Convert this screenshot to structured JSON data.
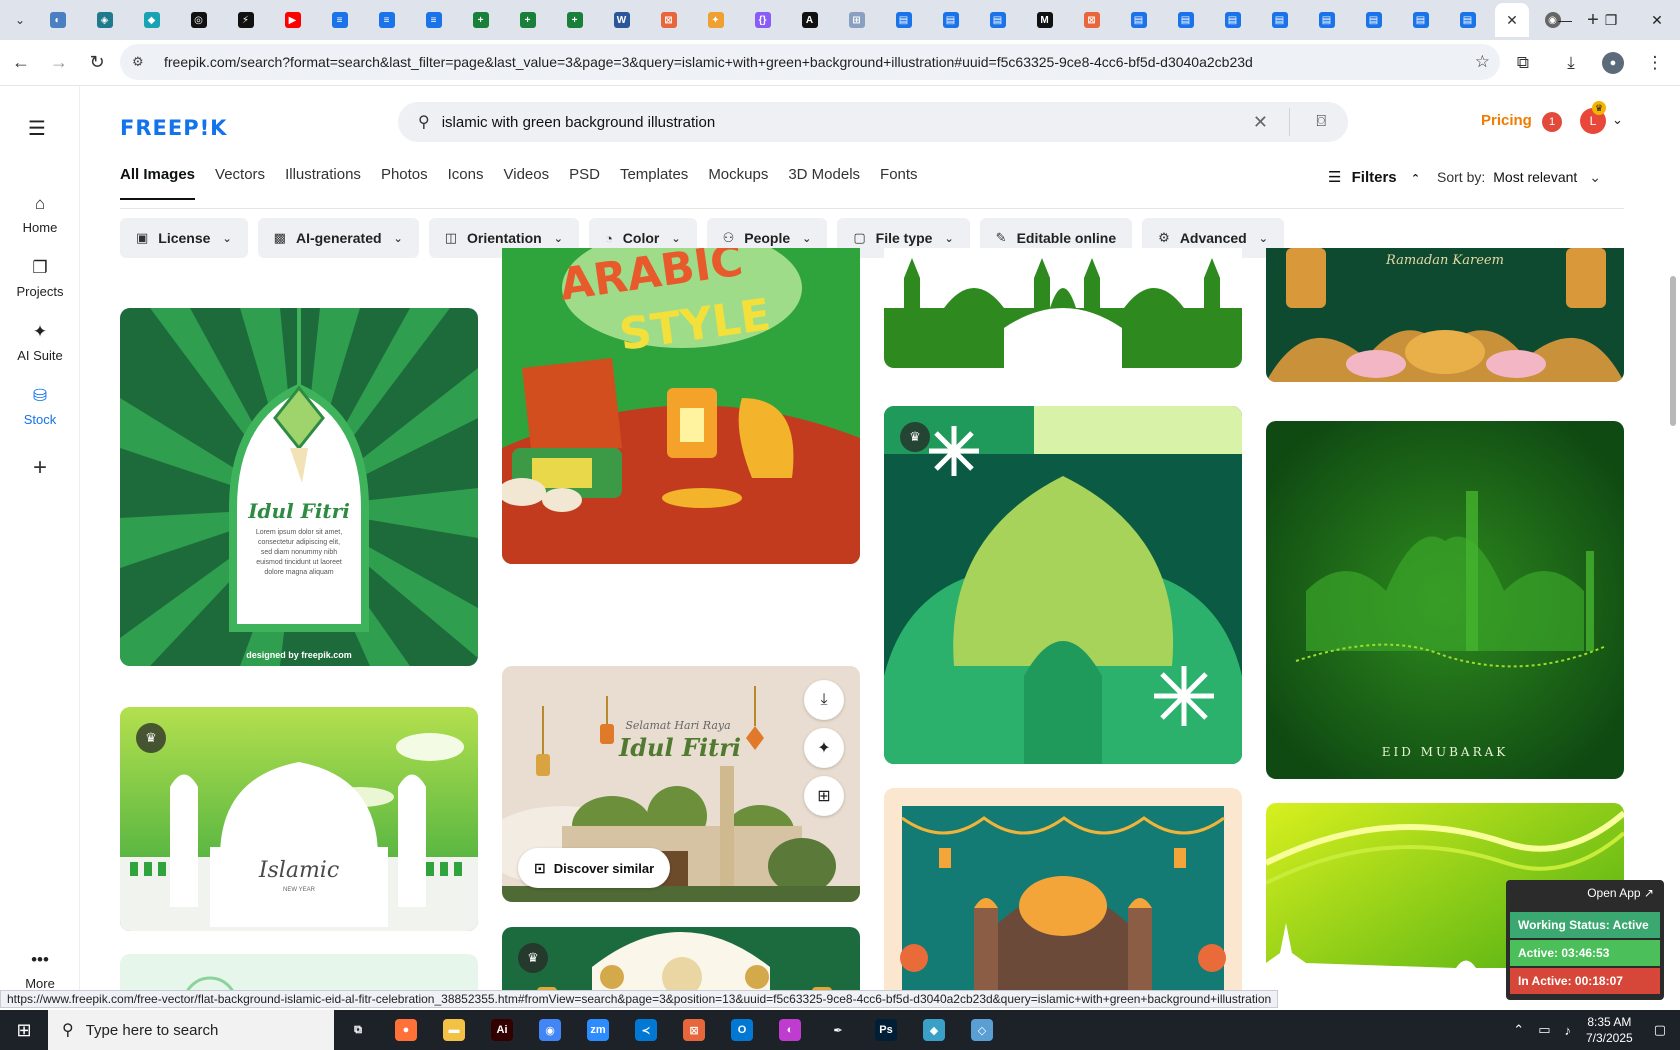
{
  "browser": {
    "tabs": [
      {
        "icon": "edge-icon",
        "color": "#4a7fc1",
        "glyph": "◐"
      },
      {
        "icon": "vpn-icon",
        "color": "#1f7a8c",
        "glyph": "◈"
      },
      {
        "icon": "app-icon",
        "color": "#18a3b5",
        "glyph": "◆"
      },
      {
        "icon": "openai-icon",
        "color": "#111111",
        "glyph": "◎"
      },
      {
        "icon": "bolt-icon",
        "color": "#111111",
        "glyph": "⚡"
      },
      {
        "icon": "youtube-icon",
        "color": "#ff0000",
        "glyph": "▶"
      },
      {
        "icon": "docs-icon",
        "color": "#1a73e8",
        "glyph": "≡"
      },
      {
        "icon": "docs-icon",
        "color": "#1a73e8",
        "glyph": "≡"
      },
      {
        "icon": "docs-icon",
        "color": "#1a73e8",
        "glyph": "≡"
      },
      {
        "icon": "sheets-icon",
        "color": "#188038",
        "glyph": "+"
      },
      {
        "icon": "sheets-icon",
        "color": "#188038",
        "glyph": "+"
      },
      {
        "icon": "sheets-icon",
        "color": "#188038",
        "glyph": "+"
      },
      {
        "icon": "word-icon",
        "color": "#2b579a",
        "glyph": "W"
      },
      {
        "icon": "app-icon",
        "color": "#e8663c",
        "glyph": "⊠"
      },
      {
        "icon": "bird-icon",
        "color": "#f0a030",
        "glyph": "✦"
      },
      {
        "icon": "code-icon",
        "color": "#8a5cf6",
        "glyph": "{}"
      },
      {
        "icon": "ai-icon",
        "color": "#111111",
        "glyph": "A"
      },
      {
        "icon": "grid-icon",
        "color": "#8aa0c0",
        "glyph": "⊞"
      },
      {
        "icon": "forms-icon",
        "color": "#1a73e8",
        "glyph": "▤"
      },
      {
        "icon": "forms-icon",
        "color": "#1a73e8",
        "glyph": "▤"
      },
      {
        "icon": "forms-icon",
        "color": "#1a73e8",
        "glyph": "▤"
      },
      {
        "icon": "medium-icon",
        "color": "#111111",
        "glyph": "M"
      },
      {
        "icon": "app-icon",
        "color": "#e8663c",
        "glyph": "⊠"
      },
      {
        "icon": "forms-icon",
        "color": "#1a73e8",
        "glyph": "▤"
      },
      {
        "icon": "forms-icon",
        "color": "#1a73e8",
        "glyph": "▤"
      },
      {
        "icon": "forms-icon",
        "color": "#1a73e8",
        "glyph": "▤"
      },
      {
        "icon": "forms-icon",
        "color": "#1a73e8",
        "glyph": "▤"
      },
      {
        "icon": "forms-icon",
        "color": "#1a73e8",
        "glyph": "▤"
      },
      {
        "icon": "forms-icon",
        "color": "#1a73e8",
        "glyph": "▤"
      },
      {
        "icon": "forms-icon",
        "color": "#1a73e8",
        "glyph": "▤"
      },
      {
        "icon": "forms-icon",
        "color": "#1a73e8",
        "glyph": "▤"
      }
    ],
    "url": "freepik.com/search?format=search&last_filter=page&last_value=3&page=3&query=islamic+with+green+background+illustration#uuid=f5c63325-9ce8-4cc6-bf5d-d3040a2cb23d",
    "status_url": "https://www.freepik.com/free-vector/flat-background-islamic-eid-al-fitr-celebration_38852355.htm#fromView=search&page=3&position=13&uuid=f5c63325-9ce8-4cc6-bf5d-d3040a2cb23d&query=islamic+with+green+background+illustration"
  },
  "header": {
    "logo": "FREEP!K",
    "search_value": "islamic with green background illustration",
    "pricing": "Pricing",
    "notif_count": "1",
    "user_initial": "L"
  },
  "sidebar": {
    "items": [
      {
        "label": "Home",
        "icon": "⌂"
      },
      {
        "label": "Projects",
        "icon": "❐"
      },
      {
        "label": "AI Suite",
        "icon": "✦"
      },
      {
        "label": "Stock",
        "icon": "⛁"
      }
    ],
    "more": "More"
  },
  "categories": [
    "All Images",
    "Vectors",
    "Illustrations",
    "Photos",
    "Icons",
    "Videos",
    "PSD",
    "Templates",
    "Mockups",
    "3D Models",
    "Fonts"
  ],
  "filters_label": "Filters",
  "sort": {
    "label": "Sort by:",
    "value": "Most relevant"
  },
  "chips": [
    {
      "label": "License",
      "icon": "▣"
    },
    {
      "label": "AI-generated",
      "icon": "▩"
    },
    {
      "label": "Orientation",
      "icon": "◫"
    },
    {
      "label": "Color",
      "icon": "◔"
    },
    {
      "label": "People",
      "icon": "⚇"
    },
    {
      "label": "File type",
      "icon": "▢"
    },
    {
      "label": "Editable online",
      "icon": "✎"
    },
    {
      "label": "Advanced",
      "icon": "⚙"
    }
  ],
  "images": {
    "idul_fitri_title": "Idul Fitri",
    "idul_fitri_body": "Lorem ipsum dolor sit amet, consectetur adipiscing elit, sed diam nonummy nibh euismod tincidunt ut laoreet dolore magna aliquam",
    "watermark": "designed by freepik.com",
    "arabic_1": "ARABIC",
    "arabic_2": "STYLE",
    "ramadan": "Ramadan Kareem",
    "selamat": "Selamat Hari Raya",
    "idul_fitri_2": "Idul Fitri",
    "islamic": "Islamic",
    "new_year": "NEW YEAR",
    "eid": "EID MUBARAK"
  },
  "hover": {
    "discover": "Discover similar"
  },
  "work_status": {
    "open_app": "Open App ↗",
    "status": "Working Status: Active",
    "active": "Active: 03:46:53",
    "inactive": "In Active: 00:18:07",
    "status_color": "#2d8f5e",
    "active_color": "#4caf50",
    "inactive_color": "#c0392b"
  },
  "taskbar": {
    "search_placeholder": "Type here to search",
    "apps": [
      {
        "name": "task-view",
        "glyph": "⧉",
        "color": "transparent"
      },
      {
        "name": "firefox",
        "glyph": "●",
        "color": "#ff7139"
      },
      {
        "name": "file-explorer",
        "glyph": "▬",
        "color": "#f3c244"
      },
      {
        "name": "illustrator",
        "glyph": "Ai",
        "color": "#330000"
      },
      {
        "name": "chrome",
        "glyph": "◉",
        "color": "#4285f4"
      },
      {
        "name": "zoom",
        "glyph": "zm",
        "color": "#2d8cff"
      },
      {
        "name": "vscode",
        "glyph": "≺",
        "color": "#0078d4"
      },
      {
        "name": "app",
        "glyph": "⊠",
        "color": "#e8663c"
      },
      {
        "name": "outlook",
        "glyph": "O",
        "color": "#0078d4"
      },
      {
        "name": "app",
        "glyph": "◐",
        "color": "#c03bd0"
      },
      {
        "name": "pen",
        "glyph": "✒",
        "color": "transparent"
      },
      {
        "name": "photoshop",
        "glyph": "Ps",
        "color": "#001e36"
      },
      {
        "name": "app",
        "glyph": "◆",
        "color": "#3aa0c8"
      },
      {
        "name": "app",
        "glyph": "◇",
        "color": "#5a9fd4"
      }
    ],
    "time": "8:35 AM",
    "date": "7/3/2025"
  }
}
